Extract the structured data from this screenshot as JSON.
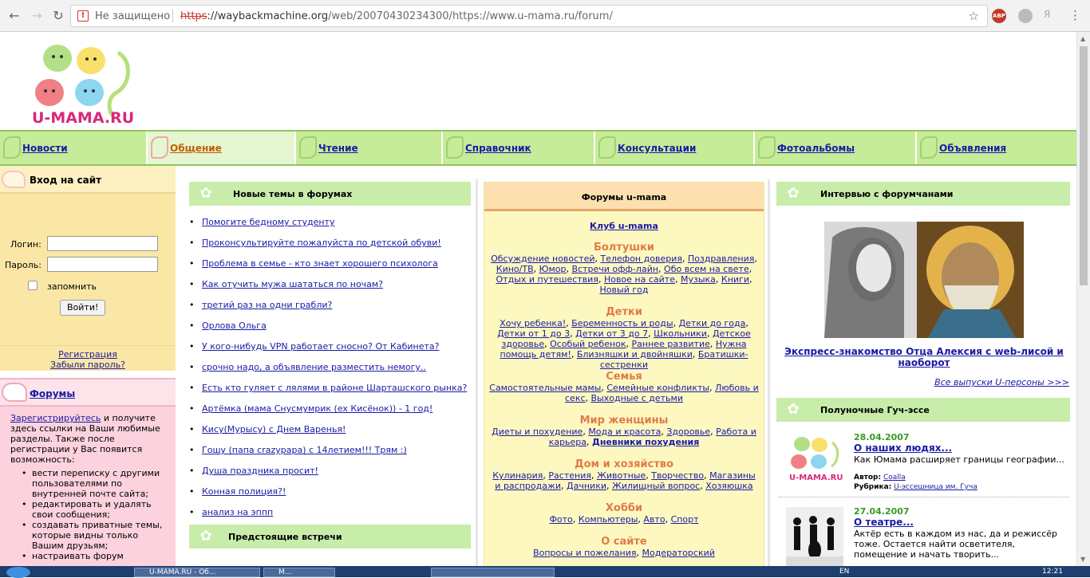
{
  "browser": {
    "security_label": "Не защищено",
    "url_scheme": "https",
    "url_host": "://wayback​machine.org",
    "url_rest": "/web/20070430234300/https://www.u-mama.ru/forum/",
    "ext_label": "ABP",
    "ext3_label": "Я"
  },
  "logo": {
    "text": "U-MAMA.RU"
  },
  "topnav": [
    {
      "label": "Новости"
    },
    {
      "label": "Общение"
    },
    {
      "label": "Чтение"
    },
    {
      "label": "Справочник"
    },
    {
      "label": "Консультации"
    },
    {
      "label": "Фотоальбомы"
    },
    {
      "label": "Объявления"
    }
  ],
  "login": {
    "title": "Вход на сайт",
    "login_label": "Логин:",
    "password_label": "Пароль:",
    "remember_label": "запомнить",
    "submit_label": "Войти!",
    "register_link": "Регистрация",
    "forgot_link": "Забыли пароль?"
  },
  "forums_box": {
    "title": "Форумы",
    "register_link": "Зарегистрируйтесь",
    "intro": " и получите здесь ссылки на Ваши любимые разделы. Также после регистрации у Вас появится возможность:",
    "items": [
      "вести переписку с другими пользователями по внутренней почте сайта;",
      "редактировать и удалять свои сообщения;",
      "создавать приватные темы, которые видны только Вашим друзьям;",
      "настраивать форум"
    ]
  },
  "new_topics": {
    "title": "Новые темы в форумах",
    "items": [
      "Помогите бедному студенту",
      "Проконсультируйте пожалуйста по детской обуви!",
      "Проблема в семье - кто знает хорошего психолога",
      "Как отучить мужа шататься по ночам?",
      "третий раз на одни грабли?",
      "Орлова Ольга",
      "У кого-нибудь VPN работает сносно? От Кабинета?",
      "срочно надо, а объявление разместить немогу..",
      "Есть кто гуляет с лялями в районе Шарташского рынка?",
      "Артёмка (мама Снусмумрик (ex Кисёнок)) - 1 год!",
      "Кису(Мурысу) с Днем Варенья!",
      "Гошу (папа crazypapa) с 14летием!!! Трям :)",
      "Душа праздника просит!",
      "Конная полиция?!",
      "анализ на эппп"
    ]
  },
  "upcoming": {
    "title": "Предстоящие встречи"
  },
  "forums_center": {
    "title": "Форумы u-mama",
    "club": "Клуб u-mama",
    "categories": [
      {
        "title": "Болтушки",
        "links": [
          "Обсуждение новостей",
          "Телефон доверия",
          "Поздравления",
          "Кино/ТВ",
          "Юмор",
          "Встречи офф-лайн",
          "Обо всем на свете",
          "Отдых и путешествия",
          "Новое на сайте",
          "Музыка",
          "Книги",
          "Новый год"
        ]
      },
      {
        "title": "Детки",
        "links": [
          "Хочу ребенка!",
          "Беременность и роды",
          "Детки до года",
          "Детки от 1 до 3",
          "Детки от 3 до 7",
          "Школьники",
          "Детское здоровье",
          "Особый ребенок",
          "Раннее развитие",
          "Нужна помощь детям!",
          "Близняшки и двойняшки",
          "Братишки-сестренки"
        ]
      },
      {
        "title": "Семья",
        "links": [
          "Самостоятельные мамы",
          "Семейные конфликты",
          "Любовь и секс",
          "Выходные с детьми"
        ]
      },
      {
        "title": "Мир женщины",
        "links": [
          "Диеты и похудение",
          "Мода и красота",
          "Здоровье",
          "Работа и карьера",
          "Дневники похудения"
        ]
      },
      {
        "title": "Дом и хозяйство",
        "links": [
          "Кулинария",
          "Растения",
          "Животные",
          "Творчество",
          "Магазины и распродажи",
          "Дачники",
          "Жилищный вопрос",
          "Хозяюшка"
        ]
      },
      {
        "title": "Хобби",
        "links": [
          "Фото",
          "Компьютеры",
          "Авто",
          "Спорт"
        ]
      },
      {
        "title": "О сайте",
        "links": [
          "Вопросы и пожелания",
          "Модераторский"
        ]
      }
    ]
  },
  "interview": {
    "title": "Интервью с форумчанами",
    "article": "Экспресс-знакомство Отца Алексия с web-лисой и наоборот",
    "more": "Все выпуски U-персоны >>>"
  },
  "essays": {
    "title": "Полуночные Гуч-эссе",
    "items": [
      {
        "date": "28.04.2007",
        "title": "О наших людях...",
        "desc": "Как Юмама расширяет границы географии...",
        "author_label": "Автор:",
        "author": "Coalla",
        "rubric_label": "Рубрика:",
        "rubric": "U-эссешница им. Гуча"
      },
      {
        "date": "27.04.2007",
        "title": "О театре...",
        "desc": "Актёр есть в каждом из нас, да и режиссёр тоже. Остается найти осветителя, помещение и начать творить..."
      }
    ]
  },
  "taskbar": {
    "tasks": [
      "U-MAMA.RU - Об...",
      "M..."
    ],
    "lang": "EN",
    "clock": "12:21"
  }
}
